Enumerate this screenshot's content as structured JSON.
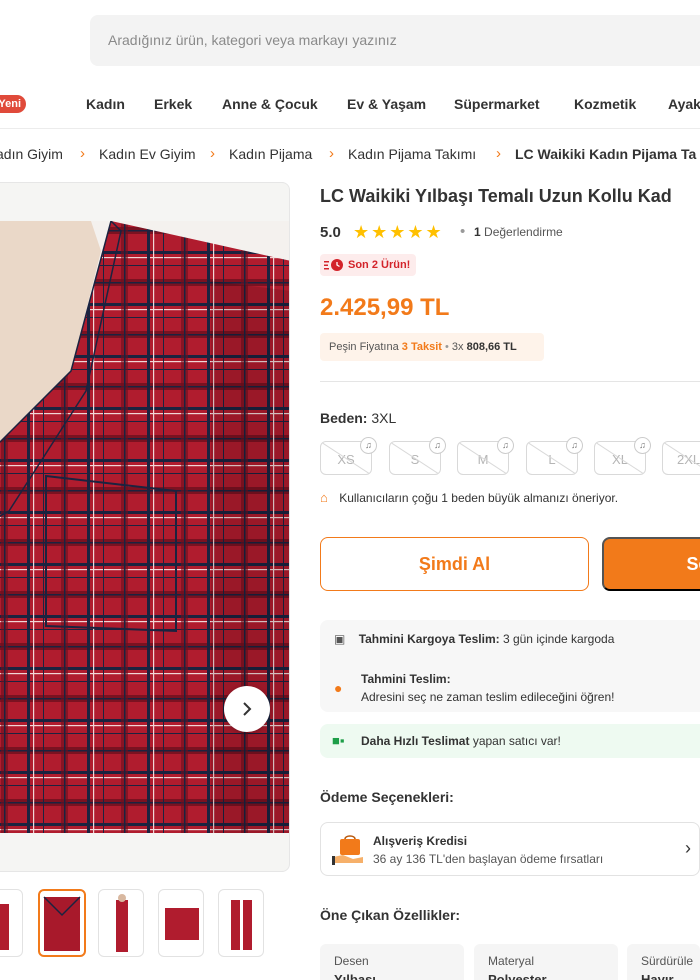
{
  "search": {
    "placeholder": "Aradığınız ürün, kategori veya markayı yazınız"
  },
  "nav": {
    "new_badge": "Yeni",
    "categories": [
      "Kadın",
      "Erkek",
      "Anne & Çocuk",
      "Ev & Yaşam",
      "Süpermarket",
      "Kozmetik",
      "Ayak"
    ]
  },
  "breadcrumb": [
    "adın Giyim",
    "Kadın Ev Giyim",
    "Kadın Pijama",
    "Kadın Pijama Takımı",
    "LC Waikiki Kadın Pijama Ta"
  ],
  "product": {
    "brand": "LC Waikiki",
    "name": "Yılbaşı Temalı Uzun Kollu Kad",
    "rating_score": "5.0",
    "stars": "★★★★★",
    "rating_dot": "•",
    "rating_count": "1",
    "rating_label": "Değerlendirme",
    "stock_badge": "Son 2 Ürün!",
    "price": "2.425,99 TL",
    "installment": {
      "prefix": "Peşin Fiyatına",
      "highlight": "3 Taksit",
      "dot": "•",
      "count": "3x",
      "amount": "808,66 TL"
    }
  },
  "size": {
    "label": "Beden:",
    "selected": "3XL",
    "options": [
      "XS",
      "S",
      "M",
      "L",
      "XL",
      "2XL"
    ],
    "tip": "Kullanıcıların çoğu 1 beden büyük almanızı öneriyor."
  },
  "actions": {
    "buy_now": "Şimdi Al",
    "add_to_cart": "Sep"
  },
  "delivery": {
    "cargo_label": "Tahmini Kargoya Teslim:",
    "cargo_value": "3 gün içinde kargoda",
    "eta_title": "Tahmini Teslim:",
    "eta_text": "Adresini seç ne zaman teslim edileceğini öğren!",
    "fast_label": "Daha Hızlı Teslimat",
    "fast_text": "yapan satıcı var!"
  },
  "payment": {
    "title": "Ödeme Seçenekleri:",
    "credit_title": "Alışveriş Kredisi",
    "credit_text": "36 ay 136 TL'den başlayan ödeme fırsatları"
  },
  "features": {
    "title": "Öne Çıkan Özellikler:",
    "items": [
      {
        "key": "Desen",
        "value": "Yılbaşı"
      },
      {
        "key": "Materyal",
        "value": "Polyester"
      },
      {
        "key": "Sürdürüle",
        "value": "Hayır"
      }
    ]
  },
  "colors": {
    "accent": "#f27a1a",
    "danger": "#d3232a",
    "success": "#1e9e48"
  }
}
